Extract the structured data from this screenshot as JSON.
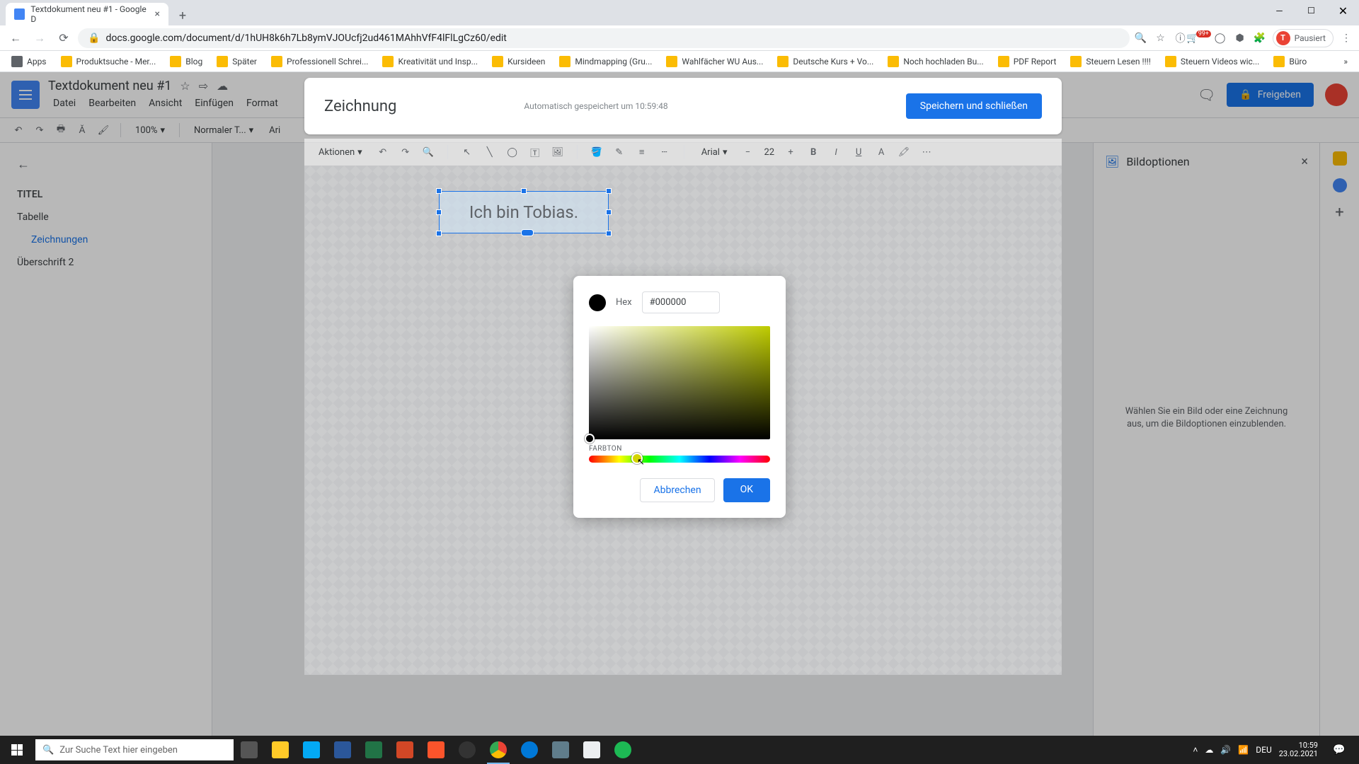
{
  "browser": {
    "tab_title": "Textdokument neu #1 - Google D",
    "url": "docs.google.com/document/d/1hUH8k6h7Lb8ymVJOUcfj2ud461MAhhVfF4lFlLgCz60/edit",
    "profile_status": "Pausiert",
    "ext_badge": "99+"
  },
  "bookmarks": [
    "Apps",
    "Produktsuche - Mer...",
    "Blog",
    "Später",
    "Professionell Schrei...",
    "Kreativität und Insp...",
    "Kursideen",
    "Mindmapping (Gru...",
    "Wahlfächer WU Aus...",
    "Deutsche Kurs + Vo...",
    "Noch hochladen Bu...",
    "PDF Report",
    "Steuern Lesen !!!!",
    "Steuern Videos wic...",
    "Büro"
  ],
  "docs": {
    "title": "Textdokument neu #1",
    "menus": [
      "Datei",
      "Bearbeiten",
      "Ansicht",
      "Einfügen",
      "Format"
    ],
    "share": "Freigeben",
    "toolbar": {
      "zoom": "100%",
      "style": "Normaler T...",
      "font": "Ari"
    }
  },
  "outline": {
    "items": [
      "TITEL",
      "Tabelle",
      "Zeichnungen",
      "Überschrift 2"
    ]
  },
  "rightpane": {
    "title": "Bildoptionen",
    "message": "Wählen Sie ein Bild oder eine Zeichnung aus, um die Bildoptionen einzublenden."
  },
  "drawing": {
    "title": "Zeichnung",
    "status": "Automatisch gespeichert um 10:59:48",
    "save": "Speichern und schließen",
    "actions": "Aktionen",
    "font": "Arial",
    "fontsize": "22",
    "textbox_text": "Ich bin Tobias."
  },
  "colorpicker": {
    "hex_label": "Hex",
    "hex_value": "#000000",
    "hue_label": "FARBTON",
    "cancel": "Abbrechen",
    "ok": "OK"
  },
  "taskbar": {
    "search_placeholder": "Zur Suche Text hier eingeben",
    "lang": "DEU",
    "time": "10:59",
    "date": "23.02.2021"
  }
}
